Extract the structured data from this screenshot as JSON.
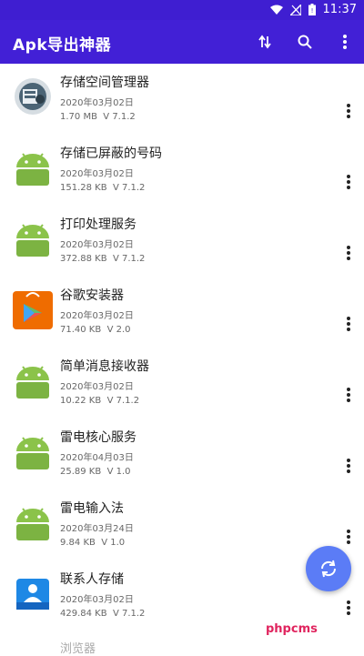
{
  "status_bar": {
    "time": "11:37"
  },
  "app_bar": {
    "title": "Apk导出神器",
    "actions": [
      "sort-icon",
      "search-icon",
      "more-vert-icon"
    ],
    "color": "#4220d6"
  },
  "apps": [
    {
      "name": "存储空间管理器",
      "date": "2020年03月02日",
      "size": "1.70 MB",
      "version": "V 7.1.2",
      "icon": "storage-manager-icon"
    },
    {
      "name": "存储已屏蔽的号码",
      "date": "2020年03月02日",
      "size": "151.28 KB",
      "version": "V 7.1.2",
      "icon": "android-icon"
    },
    {
      "name": "打印处理服务",
      "date": "2020年03月02日",
      "size": "372.88 KB",
      "version": "V 7.1.2",
      "icon": "android-icon"
    },
    {
      "name": "谷歌安装器",
      "date": "2020年03月02日",
      "size": "71.40 KB",
      "version": "V 2.0",
      "icon": "google-installer-icon"
    },
    {
      "name": "简单消息接收器",
      "date": "2020年03月02日",
      "size": "10.22 KB",
      "version": "V 7.1.2",
      "icon": "android-icon"
    },
    {
      "name": "雷电核心服务",
      "date": "2020年04月03日",
      "size": "25.89 KB",
      "version": "V 1.0",
      "icon": "android-icon"
    },
    {
      "name": "雷电输入法",
      "date": "2020年03月24日",
      "size": "9.84 KB",
      "version": "V 1.0",
      "icon": "android-icon"
    },
    {
      "name": "联系人存储",
      "date": "2020年03月02日",
      "size": "429.84 KB",
      "version": "V 7.1.2",
      "icon": "contacts-storage-icon"
    }
  ],
  "partial_item": "浏览器",
  "fab": {
    "icon": "refresh-icon",
    "color": "#5b7cf6"
  },
  "watermark": "phpcms"
}
